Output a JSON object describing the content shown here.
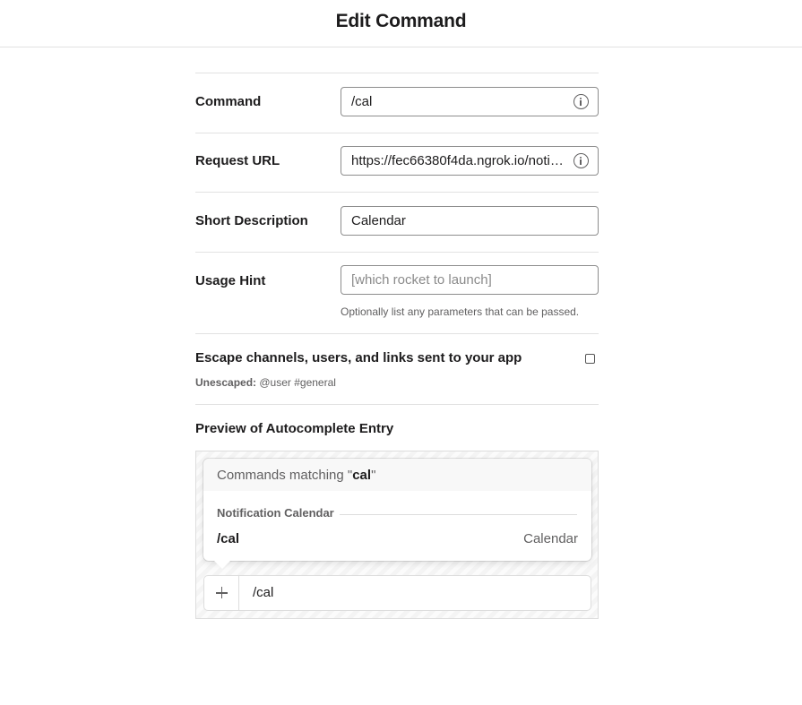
{
  "page": {
    "title": "Edit Command"
  },
  "form": {
    "command": {
      "label": "Command",
      "value": "/cal"
    },
    "request_url": {
      "label": "Request URL",
      "value": "https://fec66380f4da.ngrok.io/notif…"
    },
    "short_description": {
      "label": "Short Description",
      "value": "Calendar"
    },
    "usage_hint": {
      "label": "Usage Hint",
      "placeholder": "[which rocket to launch]",
      "help": "Optionally list any parameters that can be passed."
    },
    "escape": {
      "label": "Escape channels, users, and links sent to your app",
      "checked": false,
      "sub_label": "Unescaped:",
      "sub_value": "@user #general"
    }
  },
  "preview": {
    "title": "Preview of Autocomplete Entry",
    "matching_prefix": "Commands matching \"",
    "matching_term": "cal",
    "matching_suffix": "\"",
    "group_name": "Notification Calendar",
    "command": "/cal",
    "description": "Calendar",
    "composer_text": "/cal"
  },
  "icons": {
    "info": "info-circle-icon",
    "plus": "plus-icon"
  }
}
